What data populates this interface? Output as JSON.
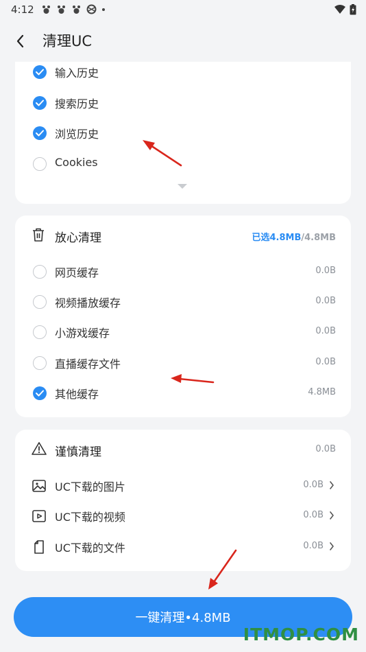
{
  "status_bar": {
    "time": "4:12"
  },
  "header": {
    "title": "清理UC"
  },
  "privacy_section": {
    "items": [
      {
        "label": "输入历史",
        "checked": true
      },
      {
        "label": "搜索历史",
        "checked": true
      },
      {
        "label": "浏览历史",
        "checked": true
      },
      {
        "label": "Cookies",
        "checked": false
      }
    ]
  },
  "safe_clean": {
    "title": "放心清理",
    "selected": "已选4.8MB",
    "total": "/4.8MB",
    "items": [
      {
        "label": "网页缓存",
        "size": "0.0B",
        "checked": false
      },
      {
        "label": "视频播放缓存",
        "size": "0.0B",
        "checked": false
      },
      {
        "label": "小游戏缓存",
        "size": "0.0B",
        "checked": false
      },
      {
        "label": "直播缓存文件",
        "size": "0.0B",
        "checked": false
      },
      {
        "label": "其他缓存",
        "size": "4.8MB",
        "checked": true
      }
    ]
  },
  "careful_clean": {
    "title": "谨慎清理",
    "size": "0.0B",
    "items": [
      {
        "label": "UC下载的图片",
        "size": "0.0B",
        "icon": "image-icon"
      },
      {
        "label": "UC下载的视频",
        "size": "0.0B",
        "icon": "video-icon"
      },
      {
        "label": "UC下载的文件",
        "size": "0.0B",
        "icon": "file-icon"
      }
    ]
  },
  "clean_button": {
    "label": "一键清理•4.8MB"
  },
  "watermark": "ITMOP.COM",
  "colors": {
    "accent": "#2a8cf3",
    "annotation_arrow": "#d9261c",
    "watermark": "#2f8f43"
  }
}
